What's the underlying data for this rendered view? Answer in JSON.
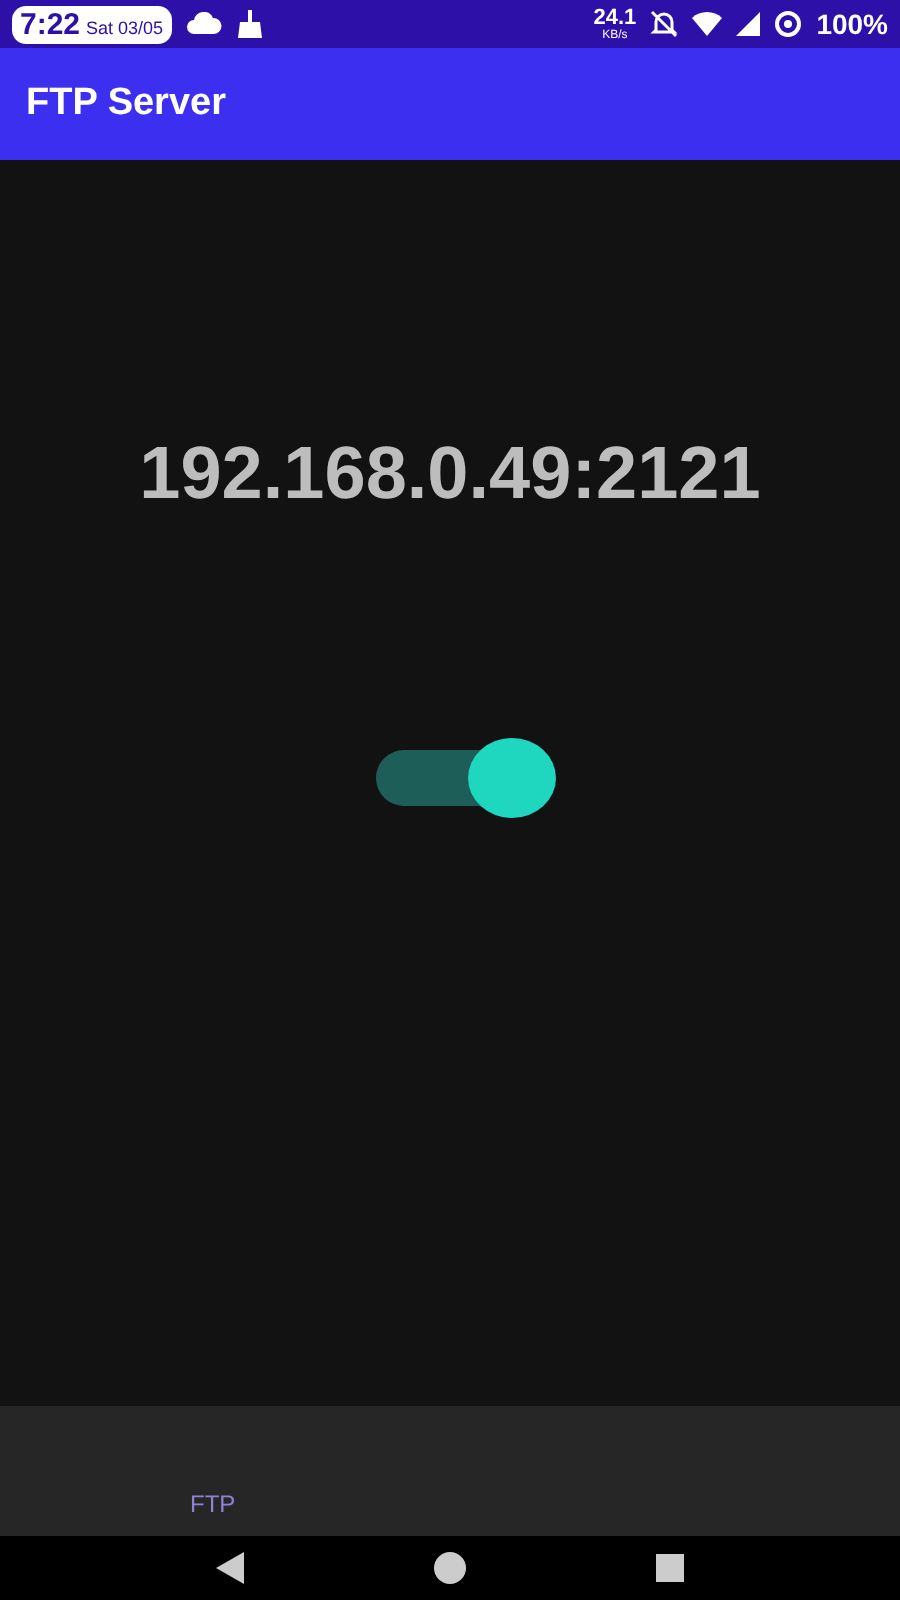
{
  "status_bar": {
    "time": "7:22",
    "date": "Sat 03/05",
    "speed": "24.1",
    "speed_unit": "KB/s",
    "battery": "100%"
  },
  "app_bar": {
    "title": "FTP Server"
  },
  "server": {
    "address": "192.168.0.49:2121",
    "switch": {
      "on": true
    }
  },
  "bottom_bar": {
    "label": "FTP"
  }
}
